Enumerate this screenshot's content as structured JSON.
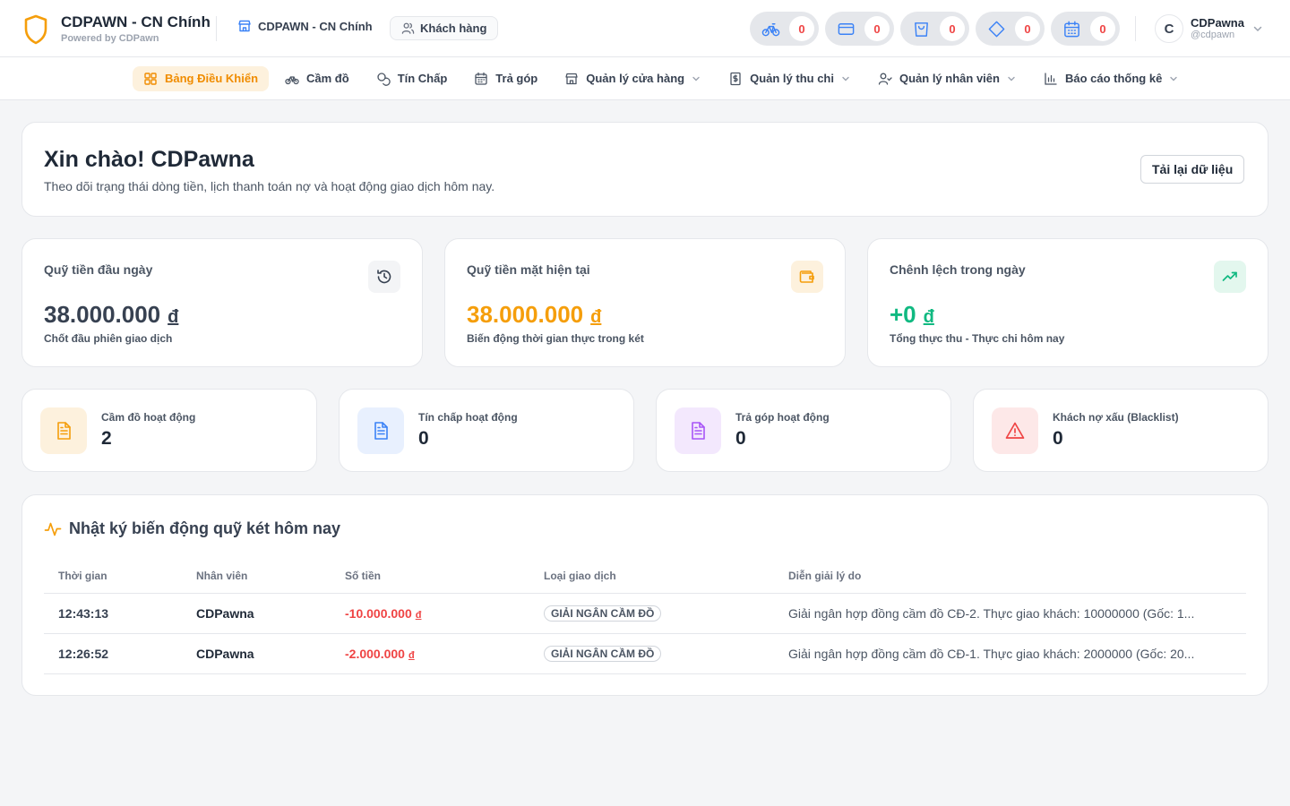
{
  "brand": {
    "name": "CDPAWN - CN Chính",
    "powered": "Powered by CDPawn",
    "accent": "#f59e0b"
  },
  "header": {
    "branch": "CDPAWN - CN Chính",
    "customers_button": "Khách hàng",
    "counters": [
      {
        "icon": "bike-icon",
        "count": "0"
      },
      {
        "icon": "card-icon",
        "count": "0"
      },
      {
        "icon": "bag-icon",
        "count": "0"
      },
      {
        "icon": "diamond-icon",
        "count": "0"
      },
      {
        "icon": "calendar-icon",
        "count": "0"
      }
    ],
    "user": {
      "initial": "C",
      "name": "CDPawna",
      "handle": "@cdpawn"
    }
  },
  "nav": {
    "items": [
      {
        "label": "Bảng Điều Khiển",
        "active": true
      },
      {
        "label": "Cầm đồ"
      },
      {
        "label": "Tín Chấp"
      },
      {
        "label": "Trả góp"
      },
      {
        "label": "Quản lý cửa hàng",
        "dropdown": true
      },
      {
        "label": "Quản lý thu chi",
        "dropdown": true
      },
      {
        "label": "Quản lý nhân viên",
        "dropdown": true
      },
      {
        "label": "Báo cáo thống kê",
        "dropdown": true
      }
    ]
  },
  "welcome": {
    "title": "Xin chào! CDPawna",
    "subtitle": "Theo dõi trạng thái dòng tiền, lịch thanh toán nợ và hoạt động giao dịch hôm nay.",
    "reload": "Tải lại dữ liệu"
  },
  "funds": [
    {
      "label": "Quỹ tiền đầu ngày",
      "value": "38.000.000",
      "currency": "đ",
      "desc": "Chốt đầu phiên giao dịch",
      "color": "#374151"
    },
    {
      "label": "Quỹ tiền mặt hiện tại",
      "value": "38.000.000",
      "currency": "đ",
      "desc": "Biến động thời gian thực trong két",
      "color": "#f59e0b"
    },
    {
      "label": "Chênh lệch trong ngày",
      "value": "+0",
      "currency": "đ",
      "desc": "Tổng thực thu - Thực chi hôm nay",
      "color": "#10b981"
    }
  ],
  "stats": [
    {
      "label": "Cầm đồ hoạt động",
      "value": "2"
    },
    {
      "label": "Tín chấp hoạt động",
      "value": "0"
    },
    {
      "label": "Trả góp hoạt động",
      "value": "0"
    },
    {
      "label": "Khách nợ xấu (Blacklist)",
      "value": "0"
    }
  ],
  "log": {
    "title": "Nhật ký biến động quỹ két hôm nay",
    "columns": [
      "Thời gian",
      "Nhân viên",
      "Số tiền",
      "Loại giao dịch",
      "Diễn giải lý do"
    ],
    "rows": [
      {
        "time": "12:43:13",
        "staff": "CDPawna",
        "amount": "-10.000.000",
        "currency": "đ",
        "type": "GIẢI NGÂN CẦM ĐỒ",
        "reason": "Giải ngân hợp đồng cầm đồ CĐ-2. Thực giao khách: 10000000 (Gốc: 1..."
      },
      {
        "time": "12:26:52",
        "staff": "CDPawna",
        "amount": "-2.000.000",
        "currency": "đ",
        "type": "GIẢI NGÂN CẦM ĐỒ",
        "reason": "Giải ngân hợp đồng cầm đồ CĐ-1. Thực giao khách: 2000000 (Gốc: 20..."
      }
    ]
  }
}
